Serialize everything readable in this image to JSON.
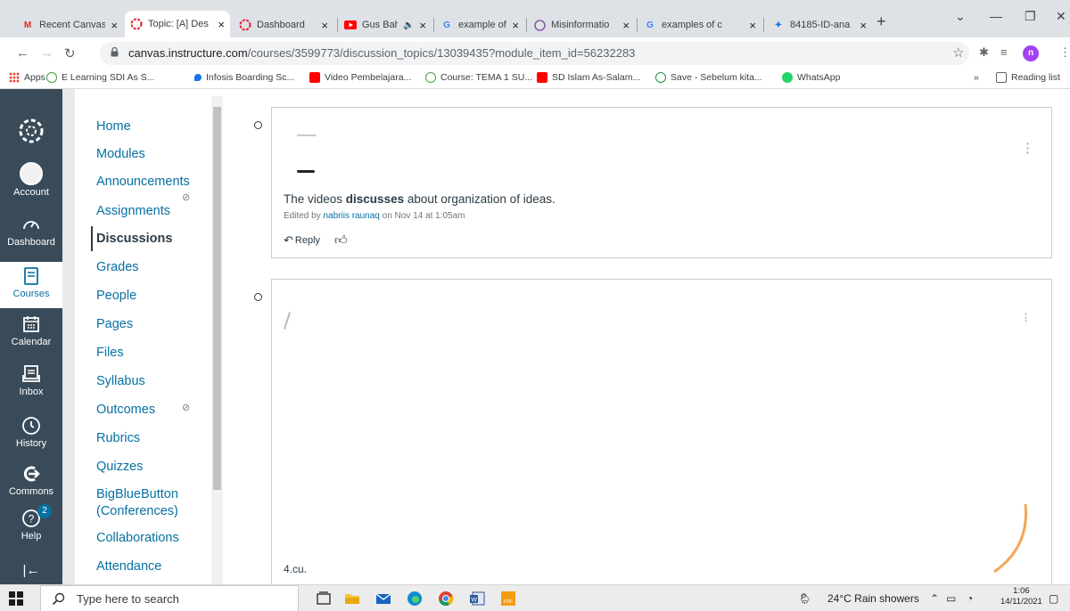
{
  "browser": {
    "tabs": [
      {
        "title": "Recent Canvas",
        "favicon": "gmail-icon"
      },
      {
        "title": "Topic: [A] Des",
        "favicon": "canvas-icon",
        "active": true
      },
      {
        "title": "Dashboard",
        "favicon": "canvas-icon"
      },
      {
        "title": "Gus Baha",
        "favicon": "youtube-icon"
      },
      {
        "title": "example of m",
        "favicon": "google-icon"
      },
      {
        "title": "Misinformatio",
        "favicon": "misinfo-icon"
      },
      {
        "title": "examples of c",
        "favicon": "google-icon"
      },
      {
        "title": "84185-ID-ana",
        "favicon": "garuda-icon"
      }
    ],
    "url_host": "canvas.instructure.com",
    "url_path": "/courses/3599773/discussion_topics/13039435?module_item_id=56232283",
    "profile_initial": "n",
    "bookmarks": [
      {
        "label": "Apps"
      },
      {
        "label": "E Learning SDI As S..."
      },
      {
        "label": "Infosis Boarding Sc..."
      },
      {
        "label": "Video Pembelajara..."
      },
      {
        "label": "Course: TEMA 1 SU..."
      },
      {
        "label": "SD Islam As-Salam..."
      },
      {
        "label": "Save - Sebelum kita..."
      },
      {
        "label": "WhatsApp"
      }
    ],
    "reading_list": "Reading list",
    "more_bookmarks": "»"
  },
  "global_nav": {
    "items": [
      {
        "label": "Account"
      },
      {
        "label": "Dashboard"
      },
      {
        "label": "Courses"
      },
      {
        "label": "Calendar"
      },
      {
        "label": "Inbox"
      },
      {
        "label": "History"
      },
      {
        "label": "Commons"
      },
      {
        "label": "Help",
        "badge": "2"
      }
    ],
    "collapse_glyph": "|←"
  },
  "course_nav": {
    "items": [
      "Home",
      "Modules",
      "Announcements",
      "Assignments",
      "Discussions",
      "Grades",
      "People",
      "Pages",
      "Files",
      "Syllabus",
      "Outcomes",
      "Rubrics",
      "Quizzes",
      "BigBlueButton",
      "(Conferences)",
      "Collaborations",
      "Attendance"
    ],
    "active": "Discussions"
  },
  "entries": [
    {
      "text_before": "The videos ",
      "text_bold": "discusses",
      "text_after": " about organization of ideas.",
      "edited_prefix": "Edited by ",
      "edited_user": "nabriis raunaq",
      "edited_suffix": " on Nov 14 at 1:05am",
      "reply_label": "Reply"
    },
    {
      "footer_text": "4.cu."
    }
  ],
  "taskbar": {
    "search_placeholder": "Type here to search",
    "weather": "24°C  Rain showers",
    "time": "1:06",
    "date": "14/11/2021"
  }
}
